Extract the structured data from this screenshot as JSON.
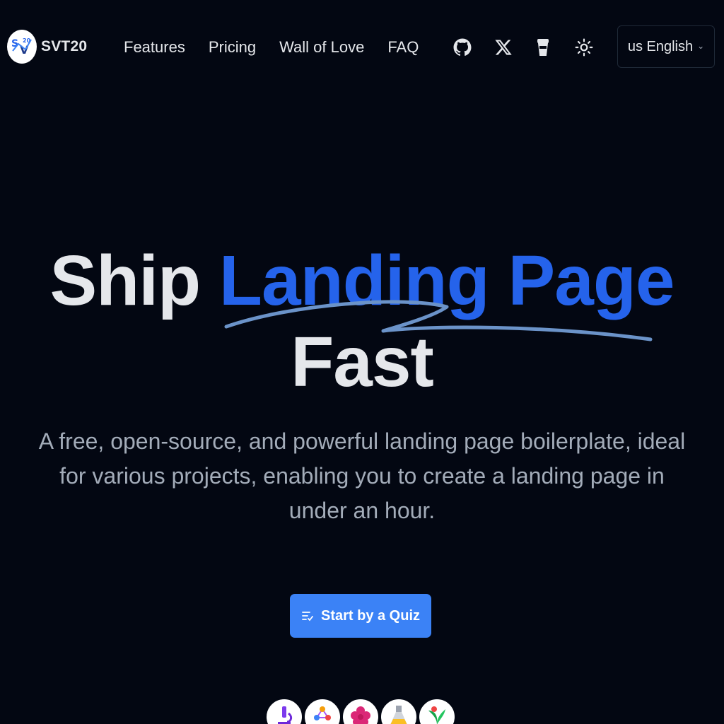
{
  "brand": {
    "name": "SVT20"
  },
  "nav": {
    "items": [
      {
        "label": "Features"
      },
      {
        "label": "Pricing"
      },
      {
        "label": "Wall of Love"
      },
      {
        "label": "FAQ"
      }
    ]
  },
  "header_icons": [
    "github-icon",
    "x-icon",
    "coffee-cup-icon",
    "sun-icon"
  ],
  "language": {
    "label": "us English"
  },
  "hero": {
    "title_part1": "Ship",
    "title_accent": "Landing Page",
    "title_part2": "Fast",
    "subtitle": "A free, open-source, and powerful landing page boilerplate, ideal for various projects, enabling you to create a landing page in under an hour.",
    "cta_label": "Start by a Quiz"
  },
  "avatars": [
    "microscope-icon",
    "molecule-icon",
    "flower-icon",
    "flask-icon",
    "plant-icon"
  ],
  "colors": {
    "background": "#030712",
    "accent": "#2563eb",
    "button": "#3b82f6",
    "squiggle": "#6b93c9",
    "text": "#e5e7eb",
    "muted": "#a3acb9"
  }
}
